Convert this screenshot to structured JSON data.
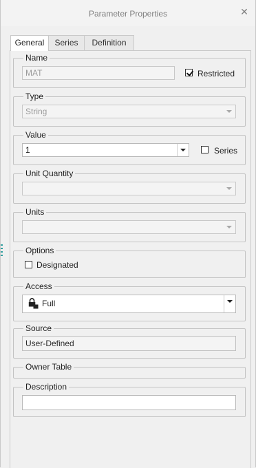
{
  "window": {
    "title": "Parameter Properties",
    "close_glyph": "✕"
  },
  "tabs": [
    {
      "label": "General",
      "active": true
    },
    {
      "label": "Series",
      "active": false
    },
    {
      "label": "Definition",
      "active": false
    }
  ],
  "name": {
    "legend": "Name",
    "value": "MAT",
    "restricted_label": "Restricted",
    "restricted_checked": true
  },
  "type": {
    "legend": "Type",
    "value": "String"
  },
  "value": {
    "legend": "Value",
    "value": "1",
    "series_label": "Series",
    "series_checked": false
  },
  "unit_quantity": {
    "legend": "Unit Quantity",
    "value": ""
  },
  "units": {
    "legend": "Units",
    "value": ""
  },
  "options": {
    "legend": "Options",
    "designated_label": "Designated",
    "designated_checked": false
  },
  "access": {
    "legend": "Access",
    "value": "Full",
    "icon": "lock-icon"
  },
  "source": {
    "legend": "Source",
    "value": "User-Defined"
  },
  "owner_table": {
    "legend": "Owner Table"
  },
  "description": {
    "legend": "Description",
    "value": ""
  },
  "colors": {
    "background": "#f0f0f0",
    "border": "#c3c3c3",
    "disabled_text": "#9a9a9a",
    "title_text": "#808080"
  }
}
